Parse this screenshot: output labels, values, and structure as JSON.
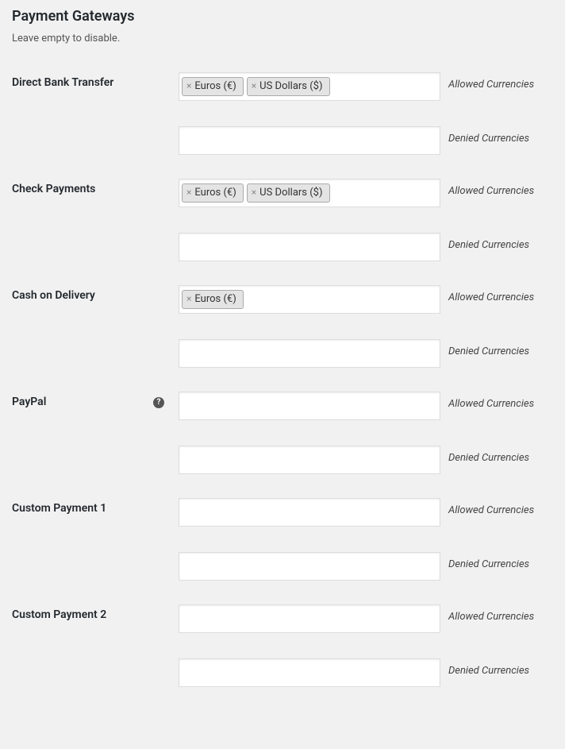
{
  "page": {
    "heading": "Payment Gateways",
    "subtitle": "Leave empty to disable."
  },
  "labels": {
    "allowed": "Allowed Currencies",
    "denied": "Denied Currencies"
  },
  "gateways": [
    {
      "id": "direct-bank-transfer",
      "label": "Direct Bank Transfer",
      "help": false,
      "allowed": [
        "Euros (€)",
        "US Dollars ($)"
      ],
      "denied": []
    },
    {
      "id": "check-payments",
      "label": "Check Payments",
      "help": false,
      "allowed": [
        "Euros (€)",
        "US Dollars ($)"
      ],
      "denied": []
    },
    {
      "id": "cash-on-delivery",
      "label": "Cash on Delivery",
      "help": false,
      "allowed": [
        "Euros (€)"
      ],
      "denied": []
    },
    {
      "id": "paypal",
      "label": "PayPal",
      "help": true,
      "allowed": [],
      "denied": []
    },
    {
      "id": "custom-payment-1",
      "label": "Custom Payment 1",
      "help": false,
      "allowed": [],
      "denied": []
    },
    {
      "id": "custom-payment-2",
      "label": "Custom Payment 2",
      "help": false,
      "allowed": [],
      "denied": []
    }
  ]
}
